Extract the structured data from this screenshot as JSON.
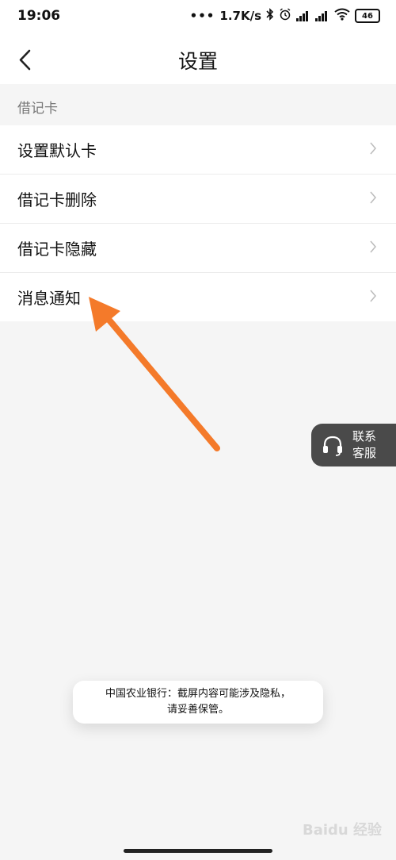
{
  "status_bar": {
    "time": "19:06",
    "net_speed": "1.7K/s",
    "battery": "46",
    "icons": [
      "dots-icon",
      "bluetooth-icon",
      "alarm-icon",
      "signal-icon",
      "hd-signal-icon",
      "wifi-icon",
      "battery-icon"
    ]
  },
  "header": {
    "title": "设置",
    "back_icon": "chevron-left-icon"
  },
  "section": {
    "title": "借记卡"
  },
  "menu": {
    "items": [
      {
        "label": "设置默认卡"
      },
      {
        "label": "借记卡删除"
      },
      {
        "label": "借记卡隐藏"
      },
      {
        "label": "消息通知"
      }
    ]
  },
  "support": {
    "line1": "联系",
    "line2": "客服",
    "icon": "headset-icon"
  },
  "toast": {
    "line1": "中国农业银行：截屏内容可能涉及隐私，",
    "line2": "请妥善保管。"
  },
  "annotation": {
    "arrow_color": "#f47a2a"
  },
  "watermark": {
    "text": "Baidu 经验"
  }
}
